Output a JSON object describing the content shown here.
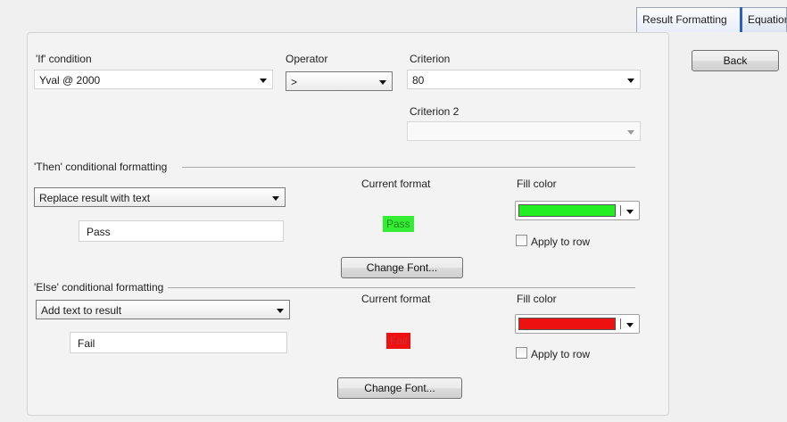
{
  "tabs": [
    {
      "label": "Result Formatting",
      "active": true
    },
    {
      "label": "Equation",
      "active": false
    }
  ],
  "back_button": "Back",
  "if_condition": {
    "label": "'If' condition",
    "value": "Yval @ 2000"
  },
  "operator": {
    "label": "Operator",
    "value": ">"
  },
  "criterion": {
    "label": "Criterion",
    "value": "80"
  },
  "criterion2": {
    "label": "Criterion 2",
    "value": ""
  },
  "then": {
    "heading": "'Then' conditional formatting",
    "mode": "Replace result with text",
    "text_value": "Pass",
    "current_format_label": "Current format",
    "current_format_sample": "Pass",
    "sample_bg": "#33ee33",
    "sample_fg": "#228822",
    "fill_color_label": "Fill color",
    "fill_color": "#22ee22",
    "apply_to_row_label": "Apply to row",
    "change_font_label": "Change Font..."
  },
  "else": {
    "heading": "'Else' conditional formatting",
    "mode": "Add text to result",
    "text_value": "Fail",
    "current_format_label": "Current format",
    "current_format_sample": "Fail",
    "sample_bg": "#ee1111",
    "sample_fg": "#cc3333",
    "fill_color_label": "Fill color",
    "fill_color": "#ee1111",
    "apply_to_row_label": "Apply to row",
    "change_font_label": "Change Font..."
  }
}
